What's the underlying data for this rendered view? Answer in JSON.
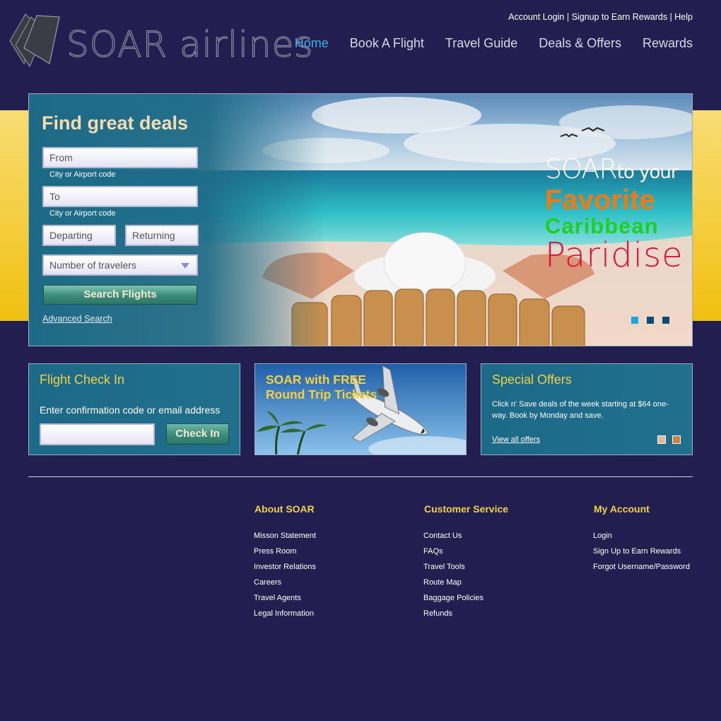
{
  "brand": {
    "logo_text": "SOAR airlines"
  },
  "utility": {
    "account_login": "Account Login",
    "sep1": " | ",
    "signup": "Signup to Earn Rewards",
    "sep2": " | ",
    "help": "Help"
  },
  "nav": {
    "items": [
      {
        "label": "Home",
        "active": true
      },
      {
        "label": "Book A Flight"
      },
      {
        "label": "Travel Guide"
      },
      {
        "label": "Deals & Offers"
      },
      {
        "label": "Rewards"
      }
    ]
  },
  "search": {
    "title": "Find great deals",
    "from_placeholder": "From",
    "from_hint": "City or Airport code",
    "to_placeholder": "To",
    "to_hint": "City or Airport code",
    "departing_placeholder": "Departing",
    "returning_placeholder": "Returning",
    "travelers_selected": "Number of travelers",
    "button": "Search Flights",
    "advanced_link": "Advanced Search"
  },
  "hero_promo": {
    "line1_big": "SOAR",
    "line1_small": "to your",
    "line2": "Favorite",
    "line3": "Caribbean",
    "line4": "Paridise"
  },
  "checkin": {
    "title": "Flight Check In",
    "label": "Enter confirmation code or email address",
    "input_value": "",
    "button": "Check In"
  },
  "free_tickets": {
    "line1": "SOAR with FREE",
    "line2": "Round Trip Tickets"
  },
  "special_offers": {
    "title": "Special Offers",
    "text": "Click n' Save deals of the week starting at $64 one-way. Book by Monday and save.",
    "link": "View all offers"
  },
  "footer": {
    "columns": [
      {
        "title": "About SOAR",
        "links": [
          "Misson Statement",
          "Press Room",
          "Investor Relations",
          "Careers",
          "Travel Agents",
          "Legal Information"
        ]
      },
      {
        "title": "Customer Service",
        "links": [
          "Contact Us",
          "FAQs",
          "Travel Tools",
          "Route Map",
          "Baggage Policies",
          "Refunds"
        ]
      },
      {
        "title": "My Account",
        "links": [
          "Login",
          "Sign Up to Earn Rewards",
          "Forgot Username/Password"
        ]
      }
    ]
  },
  "colors": {
    "background": "#221f50",
    "accent_yellow": "#f3d040",
    "nav_active": "#3fb0e8",
    "panel_teal": "#1d6a86"
  }
}
